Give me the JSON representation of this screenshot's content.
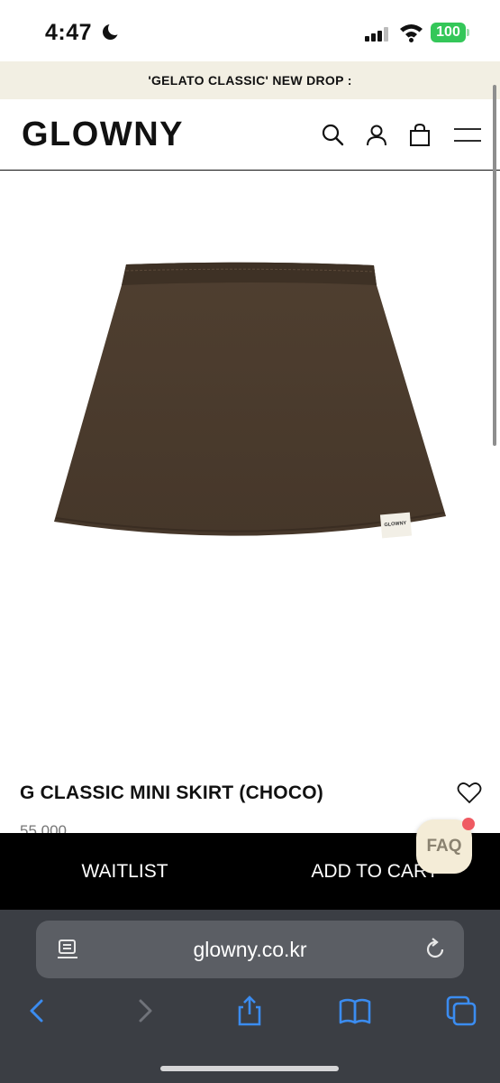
{
  "status_bar": {
    "time": "4:47",
    "battery": "100"
  },
  "promo": {
    "text": "'GELATO CLASSIC' NEW DROP :"
  },
  "header": {
    "logo": "GLOWNY",
    "icons": [
      "search-icon",
      "account-icon",
      "bag-icon",
      "menu-icon"
    ]
  },
  "product": {
    "image_label": "GLOWNY",
    "title": "G CLASSIC MINI SKIRT (CHOCO)",
    "price": "55,000",
    "color": "#4a3a2b"
  },
  "actions": {
    "waitlist": "WAITLIST",
    "add_to_cart": "ADD TO CART"
  },
  "faq": {
    "label": "FAQ"
  },
  "browser": {
    "url": "glowny.co.kr",
    "icons": [
      "reader-icon",
      "reload-icon",
      "back-icon",
      "forward-icon",
      "share-icon",
      "bookmarks-icon",
      "tabs-icon"
    ]
  },
  "colors": {
    "accent_blue": "#3b8cf0",
    "banner_bg": "#f2efe3",
    "skirt": "#4a3a2b"
  }
}
